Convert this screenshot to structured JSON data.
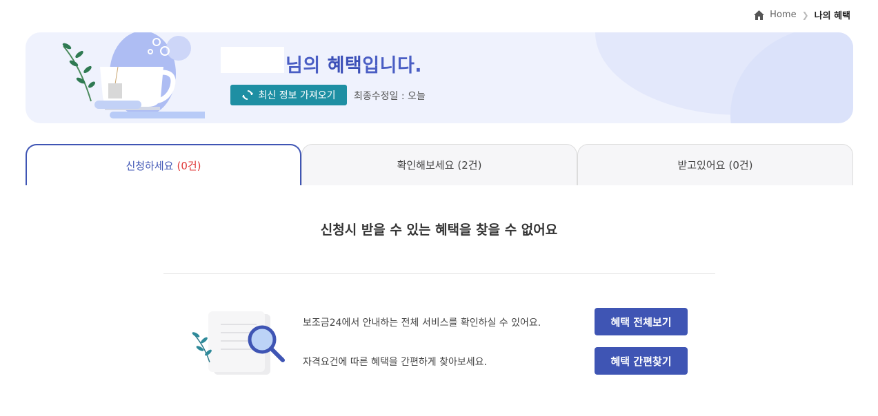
{
  "breadcrumb": {
    "home": "Home",
    "current": "나의 혜택"
  },
  "banner": {
    "suffix_plain_1": "님의 ",
    "suffix_bold": "혜택",
    "suffix_plain_2": "입니다.",
    "refresh_label": "최신 정보 가져오기",
    "updated_text": "최종수정일 : 오늘"
  },
  "tabs": [
    {
      "label": "신청하세요",
      "count": "(0건)"
    },
    {
      "label": "확인해보세요",
      "count": "(2건)"
    },
    {
      "label": "받고있어요",
      "count": "(0건)"
    }
  ],
  "empty_message": "신청시 받을 수 있는 혜택을 찾을 수 없어요",
  "info": {
    "line1": "보조금24에서 안내하는 전체 서비스를 확인하실 수 있어요.",
    "line2": "자격요건에 따른 혜택을 간편하게 찾아보세요.",
    "button_all": "혜택 전체보기",
    "button_find": "혜택 간편찾기"
  },
  "colors": {
    "accent": "#3f55b4",
    "refresh": "#1e8fa3",
    "count_red": "#e03a3a",
    "banner_bg": "#eff2fd"
  }
}
